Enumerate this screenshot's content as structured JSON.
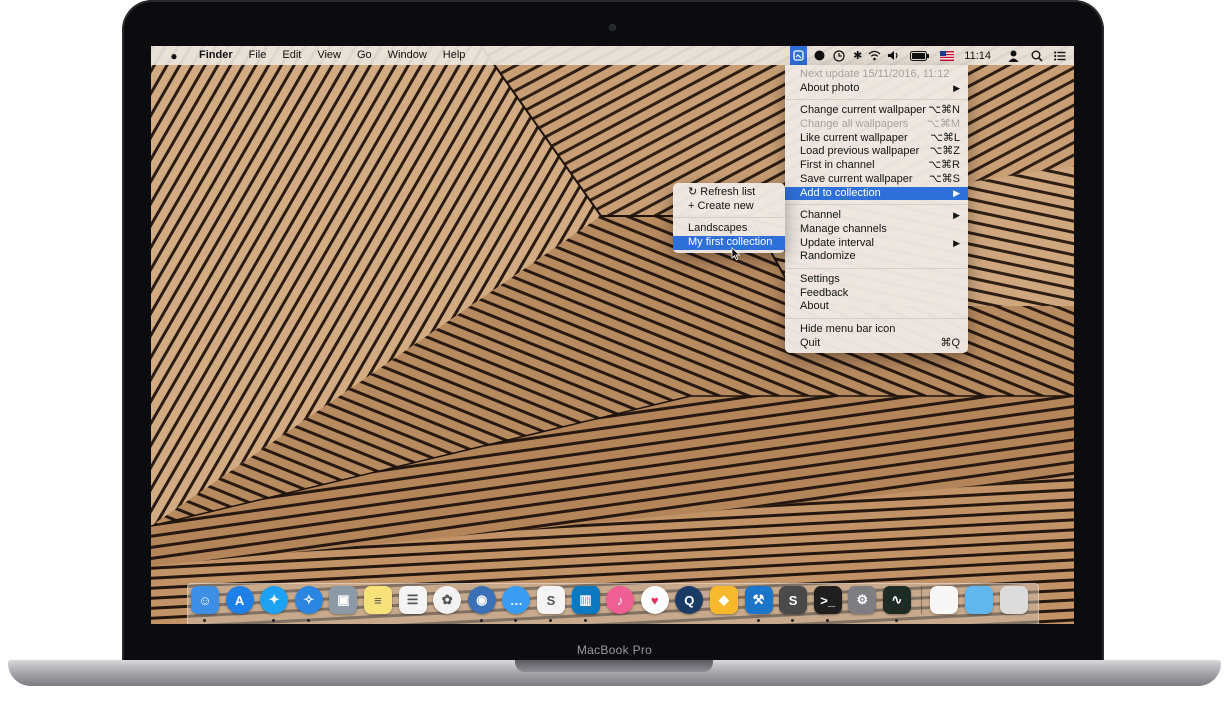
{
  "device": {
    "brand_label": "MacBook Pro"
  },
  "menubar": {
    "app_name": "Finder",
    "items": [
      "File",
      "Edit",
      "View",
      "Go",
      "Window",
      "Help"
    ],
    "clock": "11:14",
    "status_icons": [
      "wallpaper-app-icon",
      "record-icon",
      "time-machine-icon",
      "bluetooth-icon",
      "wifi-icon",
      "volume-icon",
      "battery-icon",
      "us-flag-icon",
      "user-icon",
      "spotlight-icon",
      "notification-center-icon"
    ]
  },
  "menu": {
    "next_update": "Next update 15/11/2016, 11:12",
    "about_photo": "About photo",
    "change_current": {
      "label": "Change current wallpaper",
      "shortcut": "⌥⌘N"
    },
    "change_all": {
      "label": "Change all wallpapers",
      "shortcut": "⌥⌘M"
    },
    "like_current": {
      "label": "Like current wallpaper",
      "shortcut": "⌥⌘L"
    },
    "load_previous": {
      "label": "Load previous wallpaper",
      "shortcut": "⌥⌘Z"
    },
    "first_in_channel": {
      "label": "First in channel",
      "shortcut": "⌥⌘R"
    },
    "save_current": {
      "label": "Save current wallpaper",
      "shortcut": "⌥⌘S"
    },
    "add_to_collection": "Add to collection",
    "channel": "Channel",
    "manage_channels": "Manage channels",
    "update_interval": "Update interval",
    "randomize": "Randomize",
    "settings": "Settings",
    "feedback": "Feedback",
    "about": "About",
    "hide_icon": "Hide menu bar icon",
    "quit": {
      "label": "Quit",
      "shortcut": "⌘Q"
    }
  },
  "submenu": {
    "refresh": "Refresh list",
    "create_new": "Create new",
    "collections": [
      "Landscapes",
      "My first collection"
    ],
    "highlighted": "My first collection"
  },
  "dock": {
    "apps": [
      {
        "icon": "finder-icon",
        "color": "#3d8fe6",
        "running": true
      },
      {
        "icon": "app-store-icon",
        "color": "#1f7fe8",
        "running": false
      },
      {
        "icon": "twitter-icon",
        "color": "#1da1f2",
        "running": true
      },
      {
        "icon": "safari-icon",
        "color": "#2a86e0",
        "running": true
      },
      {
        "icon": "preview-icon",
        "color": "#8c9aa8",
        "running": false
      },
      {
        "icon": "notes-icon",
        "color": "#f7e27a",
        "running": false
      },
      {
        "icon": "reminders-icon",
        "color": "#f4f4f4",
        "running": false
      },
      {
        "icon": "photos-icon",
        "color": "#f2f2f2",
        "running": false
      },
      {
        "icon": "tweetbot-icon",
        "color": "#3b6fb6",
        "running": true
      },
      {
        "icon": "messages-icon",
        "color": "#3a9cf3",
        "running": true
      },
      {
        "icon": "slack-icon",
        "color": "#f4f4f4",
        "running": true
      },
      {
        "icon": "trello-icon",
        "color": "#0b79bf",
        "running": true
      },
      {
        "icon": "itunes-icon",
        "color": "#f05f93",
        "running": false
      },
      {
        "icon": "health-icon",
        "color": "#ffffff",
        "running": false
      },
      {
        "icon": "quicktime-icon",
        "color": "#1a3b66",
        "running": false
      },
      {
        "icon": "sketch-icon",
        "color": "#f7b92b",
        "running": false
      },
      {
        "icon": "xcode-icon",
        "color": "#1b75c9",
        "running": true
      },
      {
        "icon": "sublime-text-icon",
        "color": "#4a4a4a",
        "running": true
      },
      {
        "icon": "terminal-icon",
        "color": "#1f1f1f",
        "running": true
      },
      {
        "icon": "system-preferences-icon",
        "color": "#7d7d82",
        "running": false
      },
      {
        "icon": "activity-monitor-icon",
        "color": "#1e2a24",
        "running": true
      }
    ],
    "others": [
      {
        "icon": "document-icon",
        "color": "#f7f7f7"
      },
      {
        "icon": "folder-icon",
        "color": "#62b6ee"
      },
      {
        "icon": "trash-icon",
        "color": "#dcdcdc"
      }
    ]
  }
}
